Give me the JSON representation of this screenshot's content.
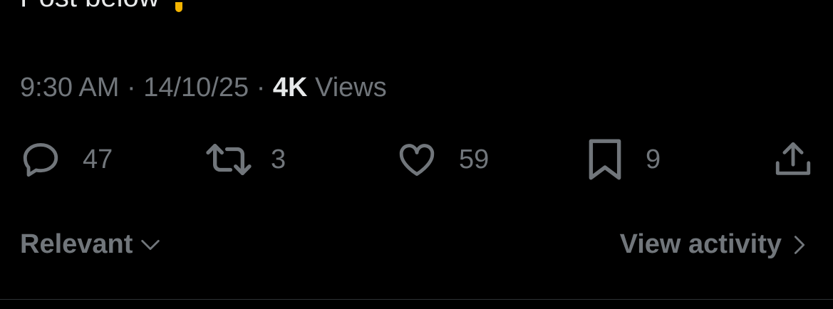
{
  "tweet": {
    "partial_text": "Post below",
    "time": "9:30 AM",
    "date": "14/10/25",
    "views_count": "4K",
    "views_label": "Views",
    "separator": "·"
  },
  "actions": {
    "reply": {
      "icon": "reply-icon",
      "count": "47"
    },
    "retweet": {
      "icon": "retweet-icon",
      "count": "3"
    },
    "like": {
      "icon": "heart-icon",
      "count": "59"
    },
    "bookmark": {
      "icon": "bookmark-icon",
      "count": "9"
    },
    "share": {
      "icon": "share-icon"
    }
  },
  "footer": {
    "sort_label": "Relevant",
    "view_activity_label": "View activity"
  },
  "colors": {
    "background": "#000000",
    "primary_text": "#e7e9ea",
    "secondary_text": "#71767b",
    "divider": "#2f3336"
  }
}
